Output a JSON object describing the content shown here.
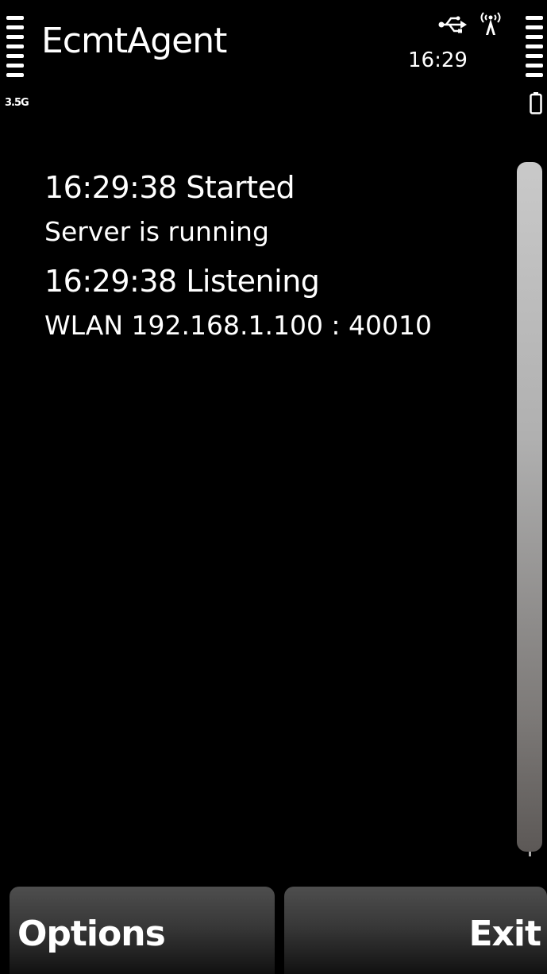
{
  "status_bar": {
    "app_title": "EcmtAgent",
    "clock": "16:29",
    "network_type": "3.5G",
    "icons": {
      "usb": "usb-icon",
      "wlan": "wlan-antenna-icon",
      "battery": "battery-icon",
      "signal": "signal-strength-icon"
    }
  },
  "log": [
    {
      "head": "16:29:38 Started",
      "sub": "Server is running"
    },
    {
      "head": "16:29:38 Listening",
      "sub": "WLAN 192.168.1.100 : 40010"
    }
  ],
  "softkeys": {
    "left_label": "Options",
    "right_label": "Exit"
  },
  "colors": {
    "background": "#000000",
    "text": "#ffffff"
  }
}
